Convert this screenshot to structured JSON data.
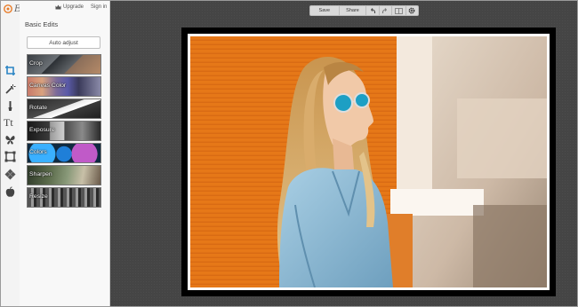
{
  "app": {
    "logo_text": "Editor",
    "upgrade_label": "Upgrade",
    "signin_label": "Sign in"
  },
  "panel": {
    "title": "Basic Edits",
    "auto_adjust_label": "Auto adjust",
    "tools": [
      {
        "label": "Crop"
      },
      {
        "label": "Canvas Color"
      },
      {
        "label": "Rotate"
      },
      {
        "label": "Exposure"
      },
      {
        "label": "Colors"
      },
      {
        "label": "Sharpen"
      },
      {
        "label": "Resize"
      }
    ]
  },
  "rail_icons": [
    "crop-icon",
    "magic-wand-icon",
    "brush-icon",
    "text-icon",
    "butterfly-icon",
    "frame-icon",
    "texture-icon",
    "apple-icon"
  ],
  "toolbar": {
    "save_label": "Save",
    "share_label": "Share"
  },
  "colors": {
    "accent": "#e87b27",
    "wall_orange": "#f07d1a",
    "jacket_blue": "#8fbcd6"
  }
}
